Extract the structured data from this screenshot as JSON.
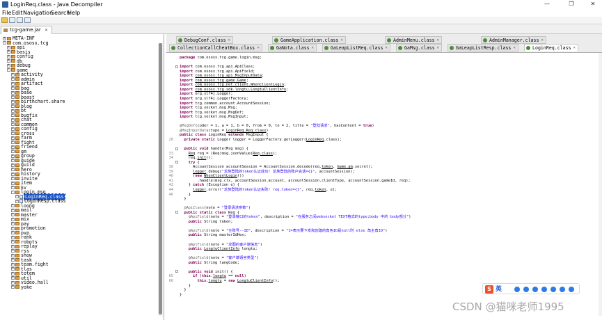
{
  "window": {
    "title": "LoginReq.class - Java Decompiler",
    "minimize_glyph": "—",
    "maximize_glyph": "❐",
    "close_glyph": "✕"
  },
  "menu": [
    "File",
    "Edit",
    "Navigation",
    "Search",
    "Help"
  ],
  "file_tab": {
    "label": "tcg-game.jar",
    "close": "✕"
  },
  "tree": [
    {
      "label": "META-INF",
      "type": "pkg",
      "exp": "+",
      "depth": 0
    },
    {
      "label": "com.ososx.tcg",
      "type": "pkg",
      "exp": "-",
      "depth": 0
    },
    {
      "label": "api",
      "type": "pkg",
      "exp": "+",
      "depth": 1
    },
    {
      "label": "basis",
      "type": "pkg",
      "exp": "+",
      "depth": 1
    },
    {
      "label": "config",
      "type": "pkg",
      "exp": "+",
      "depth": 1
    },
    {
      "label": "db",
      "type": "pkg",
      "exp": "+",
      "depth": 1
    },
    {
      "label": "debug",
      "type": "pkg",
      "exp": "+",
      "depth": 1
    },
    {
      "label": "game",
      "type": "pkg",
      "exp": "-",
      "depth": 1
    },
    {
      "label": "activity",
      "type": "pkg",
      "exp": "+",
      "depth": 2
    },
    {
      "label": "admin",
      "type": "pkg",
      "exp": "+",
      "depth": 2
    },
    {
      "label": "artifact",
      "type": "pkg",
      "exp": "+",
      "depth": 2
    },
    {
      "label": "bag",
      "type": "pkg",
      "exp": "+",
      "depth": 2
    },
    {
      "label": "base",
      "type": "pkg",
      "exp": "+",
      "depth": 2
    },
    {
      "label": "boast",
      "type": "pkg",
      "exp": "+",
      "depth": 2
    },
    {
      "label": "birthchart.share",
      "type": "pkg",
      "exp": "+",
      "depth": 2
    },
    {
      "label": "blog",
      "type": "pkg",
      "exp": "+",
      "depth": 2
    },
    {
      "label": "bt",
      "type": "pkg",
      "exp": "+",
      "depth": 2
    },
    {
      "label": "bugfix",
      "type": "pkg",
      "exp": "+",
      "depth": 2
    },
    {
      "label": "chat",
      "type": "pkg",
      "exp": "+",
      "depth": 2
    },
    {
      "label": "common",
      "type": "pkg",
      "exp": "+",
      "depth": 2
    },
    {
      "label": "config",
      "type": "pkg",
      "exp": "+",
      "depth": 2
    },
    {
      "label": "cross",
      "type": "pkg",
      "exp": "+",
      "depth": 2
    },
    {
      "label": "farm",
      "type": "pkg",
      "exp": "+",
      "depth": 2
    },
    {
      "label": "fight",
      "type": "pkg",
      "exp": "+",
      "depth": 2
    },
    {
      "label": "friend",
      "type": "pkg",
      "exp": "+",
      "depth": 2
    },
    {
      "label": "gm",
      "type": "pkg",
      "exp": "+",
      "depth": 2
    },
    {
      "label": "group",
      "type": "pkg",
      "exp": "+",
      "depth": 2
    },
    {
      "label": "guide",
      "type": "pkg",
      "exp": "+",
      "depth": 2
    },
    {
      "label": "guild",
      "type": "pkg",
      "exp": "+",
      "depth": 2
    },
    {
      "label": "hero",
      "type": "pkg",
      "exp": "+",
      "depth": 2
    },
    {
      "label": "history",
      "type": "pkg",
      "exp": "+",
      "depth": 2
    },
    {
      "label": "invite",
      "type": "pkg",
      "exp": "+",
      "depth": 2
    },
    {
      "label": "item",
      "type": "pkg",
      "exp": "+",
      "depth": 2
    },
    {
      "label": "kv",
      "type": "pkg",
      "exp": "+",
      "depth": 2
    },
    {
      "label": "login.msg",
      "type": "pkg",
      "exp": "-",
      "depth": 2
    },
    {
      "label": "LoginReq.class",
      "type": "file",
      "exp": "+",
      "depth": 3,
      "selected": true
    },
    {
      "label": "LoginResp.class",
      "type": "file",
      "exp": "+",
      "depth": 3
    },
    {
      "label": "loong",
      "type": "pkg",
      "exp": "+",
      "depth": 2
    },
    {
      "label": "mail",
      "type": "pkg",
      "exp": "+",
      "depth": 2
    },
    {
      "label": "master",
      "type": "pkg",
      "exp": "+",
      "depth": 2
    },
    {
      "label": "mix",
      "type": "pkg",
      "exp": "+",
      "depth": 2
    },
    {
      "label": "pay",
      "type": "pkg",
      "exp": "+",
      "depth": 2
    },
    {
      "label": "promotion",
      "type": "pkg",
      "exp": "+",
      "depth": 2
    },
    {
      "label": "pvp",
      "type": "pkg",
      "exp": "+",
      "depth": 2
    },
    {
      "label": "rank",
      "type": "pkg",
      "exp": "+",
      "depth": 2
    },
    {
      "label": "robots",
      "type": "pkg",
      "exp": "+",
      "depth": 2
    },
    {
      "label": "replay",
      "type": "pkg",
      "exp": "+",
      "depth": 2
    },
    {
      "label": "rss",
      "type": "pkg",
      "exp": "+",
      "depth": 2
    },
    {
      "label": "show",
      "type": "pkg",
      "exp": "+",
      "depth": 2
    },
    {
      "label": "task",
      "type": "pkg",
      "exp": "+",
      "depth": 2
    },
    {
      "label": "team.fight",
      "type": "pkg",
      "exp": "+",
      "depth": 2
    },
    {
      "label": "tlas",
      "type": "pkg",
      "exp": "+",
      "depth": 2
    },
    {
      "label": "totem",
      "type": "pkg",
      "exp": "+",
      "depth": 2
    },
    {
      "label": "util",
      "type": "pkg",
      "exp": "+",
      "depth": 2
    },
    {
      "label": "video.hall",
      "type": "pkg",
      "exp": "+",
      "depth": 2
    },
    {
      "label": "yoke",
      "type": "pkg",
      "exp": "+",
      "depth": 2
    }
  ],
  "class_tabs": [
    {
      "label": "DebugConf.class",
      "row": 0,
      "active": false
    },
    {
      "label": "GameApplication.class",
      "row": 0,
      "active": false
    },
    {
      "label": "AdminMenu.class",
      "row": 0,
      "active": false
    },
    {
      "label": "AdminManager.class",
      "row": 0,
      "active": false
    },
    {
      "label": "CollectionCallCheatBox.class",
      "row": 1,
      "active": false
    },
    {
      "label": "GaNota.class",
      "row": 1,
      "active": false
    },
    {
      "label": "GaLeapListReq.class",
      "row": 1,
      "active": false
    },
    {
      "label": "GaMsg.class",
      "row": 1,
      "active": false
    },
    {
      "label": "GaLeapListResp.class",
      "row": 1,
      "active": false
    },
    {
      "label": "LoginReq.class",
      "row": 1,
      "active": true
    }
  ],
  "code_lines": [
    {
      "ln": "",
      "fold": false,
      "html": "<span class='kw'>package</span> com.ososx.tcg.game.login.msg;"
    },
    {
      "ln": "",
      "fold": false,
      "html": ""
    },
    {
      "ln": "",
      "fold": true,
      "html": "<span class='kw'>import</span> com.ososx.tcg.api.ApiClass;"
    },
    {
      "ln": "",
      "fold": false,
      "html": "<span class='kw'>import</span> com.ososx.tcg.api.ApiField;"
    },
    {
      "ln": "",
      "fold": false,
      "html": "<span class='kw'>import</span> <span class='lk'>com.ososx.tcg.api.MsgInputData</span>;"
    },
    {
      "ln": "",
      "fold": false,
      "html": "<span class='kw'>import</span> <span class='lk'>com.ososx.tcg.game.Game</span>;"
    },
    {
      "ln": "",
      "fold": false,
      "html": "<span class='kw'>import</span> <span class='lk'>com.ososx.tcg.net.client.WhenClientLogin</span>;"
    },
    {
      "ln": "",
      "fold": false,
      "html": "<span class='kw'>import</span> <span class='lk'>com.ososx.tcg.sdk.longtu.LongtuClientInfo</span>;"
    },
    {
      "ln": "",
      "fold": false,
      "html": "<span class='kw'>import</span> org.slf4j.Logger;"
    },
    {
      "ln": "",
      "fold": false,
      "html": "<span class='kw'>import</span> org.slf4j.LoggerFactory;"
    },
    {
      "ln": "",
      "fold": false,
      "html": "<span class='kw'>import</span> tcg.common.account.AccountSession;"
    },
    {
      "ln": "",
      "fold": false,
      "html": "<span class='kw'>import</span> tcg.socket.msg.Msg;"
    },
    {
      "ln": "",
      "fold": false,
      "html": "<span class='kw'>import</span> tcg.socket.msg.MsgDef;"
    },
    {
      "ln": "",
      "fold": false,
      "html": "<span class='kw'>import</span> tcg.socket.msg.MsgInput;"
    },
    {
      "ln": "",
      "fold": false,
      "html": ""
    },
    {
      "ln": "",
      "fold": false,
      "html": "<span class='an'>@MsgDef</span>(coder = 1, a = 1, b = 0, from = 0, to = 2, title = <span class='str'>\"登陆请求\"</span>, hasContent = <span class='kw'>true</span>)"
    },
    {
      "ln": "",
      "fold": false,
      "html": "<span class='an'>@MsgInputData</span>(type = <span class='lk'>LoginReq.Req.class</span>)"
    },
    {
      "ln": "",
      "fold": false,
      "html": "<span class='kw'>public class</span> LoginReq <span class='kw'>extends</span> MsgInput {"
    },
    {
      "ln": "20",
      "fold": false,
      "html": "  <span class='kw'>private static</span> Logger logger = LoggerFactory.getLogger(<span class='lk'>LoginReq</span>.class);"
    },
    {
      "ln": "",
      "fold": false,
      "html": ""
    },
    {
      "ln": "",
      "fold": true,
      "html": "  <span class='kw'>public void</span> handle(Msg msg) {"
    },
    {
      "ln": "33",
      "fold": false,
      "html": "    <span class='lk'>Req</span> req = (Req)msg.jsonValue(<span class='lk'>Req.class</span>);"
    },
    {
      "ln": "34",
      "fold": false,
      "html": "    req.<span class='lk'>init</span>();"
    },
    {
      "ln": "",
      "fold": true,
      "html": "    <span class='kw'>try</span> {"
    },
    {
      "ln": "38",
      "fold": false,
      "html": "      AccountSession accountSession = AccountSession.decode(req.<span class='lk'>token</span>, <span class='lk'>Game.gm</span>.secret);"
    },
    {
      "ln": "39",
      "fold": false,
      "html": "      <span class='lk'>logger</span>.debug(<span class='str'>\"龙族登陆的token认证成功! 龙族登陆的账户会话={}\"</span>, accountSession);"
    },
    {
      "ln": "40",
      "fold": false,
      "html": "      (<span class='kw'>new</span> <span class='lk'>WhenClientLogin</span>())"
    },
    {
      "ln": "41",
      "fold": false,
      "html": "        .handle(msg.ctx, accountSession.account, accountSession.clientType, accountSession.gameId, req);"
    },
    {
      "ln": "42",
      "fold": false,
      "html": "    } <span class='kw'>catch</span> (Exception e) {"
    },
    {
      "ln": "44",
      "fold": false,
      "html": "      <span class='lk'>logger</span>.error(<span class='str'>\"龙族登陆的token认证失败! req.token={}\"</span>, req.<span class='lk'>token</span>, e);"
    },
    {
      "ln": "46",
      "fold": false,
      "html": "    }"
    },
    {
      "ln": "",
      "fold": false,
      "html": "  }"
    },
    {
      "ln": "",
      "fold": false,
      "html": ""
    },
    {
      "ln": "",
      "fold": false,
      "html": "  <span class='an'>@ApiClass</span>(note = <span class='str'>\"登录请求参数\"</span>)"
    },
    {
      "ln": "",
      "fold": true,
      "html": "  <span class='kw'>public static class</span> Req {"
    },
    {
      "ln": "",
      "fold": false,
      "html": "    <span class='an'>@ApiField</span>(note = <span class='str'>\"登录接口的token\"</span>, description = <span class='str'>\"在服务之间websocket TEXT格式的type;body 中的 body部分\"</span>)"
    },
    {
      "ln": "",
      "fold": false,
      "html": "    <span class='kw'>public</span> String token;"
    },
    {
      "ln": "",
      "fold": false,
      "html": ""
    },
    {
      "ln": "",
      "fold": false,
      "html": "    <span class='an'>@ApiField</span>(note = <span class='str'>\"主账号--ID\"</span>, description = <span class='str'>\"1=表示要下发和创建的角色ID是null时 else 角主角ID\"</span>)"
    },
    {
      "ln": "",
      "fold": false,
      "html": "    <span class='kw'>public</span> String masterIdHex;"
    },
    {
      "ln": "",
      "fold": false,
      "html": ""
    },
    {
      "ln": "",
      "fold": false,
      "html": "    <span class='an'>@ApiField</span>(note = <span class='str'>\"龙图的客户端信息\"</span>)"
    },
    {
      "ln": "",
      "fold": false,
      "html": "    <span class='kw'>public</span> <span class='lk'>LongtuClientInfo</span> longtu;"
    },
    {
      "ln": "",
      "fold": false,
      "html": ""
    },
    {
      "ln": "",
      "fold": false,
      "html": "    <span class='an'>@ApiField</span>(note = <span class='str'>\"客户端语言类型\"</span>)"
    },
    {
      "ln": "",
      "fold": false,
      "html": "    <span class='kw'>public</span> String langCode;"
    },
    {
      "ln": "",
      "fold": false,
      "html": ""
    },
    {
      "ln": "",
      "fold": true,
      "html": "    <span class='kw'>public void</span> init() {"
    },
    {
      "ln": "65",
      "fold": false,
      "html": "      <span class='kw'>if</span> (<span class='kw'>this</span>.<span class='lk'>longtu</span> == <span class='kw'>null</span>)"
    },
    {
      "ln": "66",
      "fold": false,
      "html": "        <span class='kw'>this</span>.<span class='lk'>longtu</span> = <span class='kw'>new</span> <span class='lk'>LongtuClientInfo</span>();"
    },
    {
      "ln": "",
      "fold": false,
      "html": "    }"
    },
    {
      "ln": "",
      "fold": false,
      "html": "  }"
    },
    {
      "ln": "",
      "fold": false,
      "html": "}"
    }
  ],
  "ime": {
    "logo": "S",
    "mode": "英"
  },
  "watermark": "CSDN @猫咪老师1995"
}
